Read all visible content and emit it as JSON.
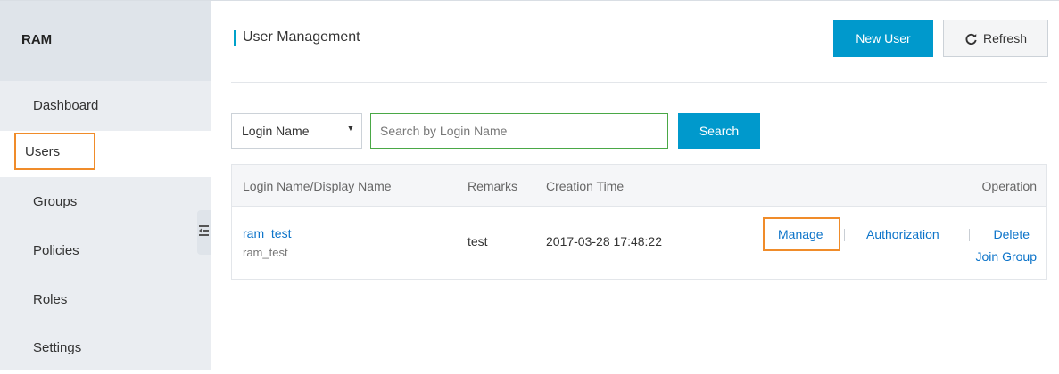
{
  "sidebar": {
    "title": "RAM",
    "items": [
      {
        "label": "Dashboard"
      },
      {
        "label": "Users"
      },
      {
        "label": "Groups"
      },
      {
        "label": "Policies"
      },
      {
        "label": "Roles"
      },
      {
        "label": "Settings"
      }
    ],
    "active_index": 1
  },
  "header": {
    "title": "User Management",
    "new_user_label": "New User",
    "refresh_label": "Refresh"
  },
  "search": {
    "field_selected": "Login Name",
    "placeholder": "Search by Login Name",
    "value": "",
    "button_label": "Search"
  },
  "table": {
    "columns": [
      "Login Name/Display Name",
      "Remarks",
      "Creation Time",
      "Operation"
    ],
    "rows": [
      {
        "login_name": "ram_test",
        "display_name": "ram_test",
        "remarks": "test",
        "creation_time": "2017-03-28 17:48:22",
        "actions": {
          "manage": "Manage",
          "authorization": "Authorization",
          "delete": "Delete",
          "join_group": "Join Group"
        }
      }
    ]
  },
  "colors": {
    "primary": "#0099cc",
    "accent_bar": "#00a2ca",
    "highlight": "#f08c2a",
    "link": "#0b73c9",
    "search_border": "#4aa846",
    "sidebar_bg": "#eaedf1"
  },
  "icons": {
    "refresh": "refresh-icon",
    "collapse": "collapse-sidebar-icon",
    "dropdown": "chevron-down-icon"
  }
}
